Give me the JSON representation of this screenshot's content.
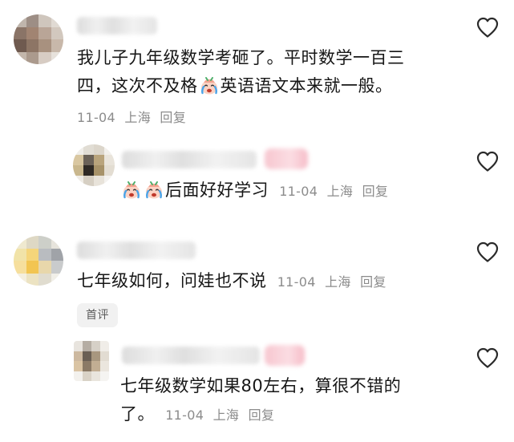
{
  "comments": [
    {
      "text_part1": "我儿子九年级数学考砸了。平时数学一百三",
      "text_part2_before": "四，这次不及格",
      "emoji": "crying-face-emoji",
      "text_part2_after": "英语语文本来就一般。",
      "date": "11-04",
      "location": "上海",
      "reply_label": "回复"
    },
    {
      "text_after_emoji": "后面好好学习",
      "date": "11-04",
      "location": "上海",
      "reply_label": "回复"
    },
    {
      "text": "七年级如何，问娃也不说",
      "date": "11-04",
      "location": "上海",
      "reply_label": "回复",
      "tag": "首评"
    },
    {
      "text_part1": "七年级数学如果80左右，算很不错的",
      "text_part2": "了。",
      "date": "11-04",
      "location": "上海",
      "reply_label": "回复"
    }
  ],
  "icons": {
    "like": "heart-outline-icon",
    "emoji": "crying-face-emoji"
  },
  "colors": {
    "text": "#161616",
    "meta": "#8c8c8c",
    "tag_bg": "#f1f1f1"
  }
}
